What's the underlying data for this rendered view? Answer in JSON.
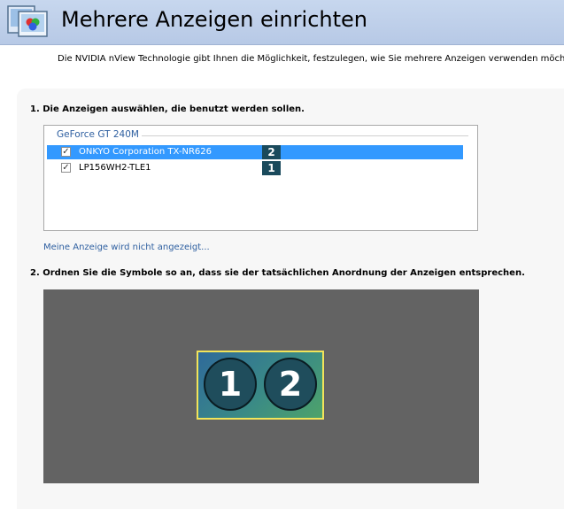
{
  "header": {
    "title": "Mehrere Anzeigen einrichten",
    "icon": "nvidia-displays-icon"
  },
  "intro": "Die NVIDIA nView Technologie gibt Ihnen die Möglichkeit, festzulegen, wie Sie mehrere Anzeigen verwenden möchten.",
  "step1": {
    "label": "1. Die Anzeigen auswählen, die benutzt werden sollen."
  },
  "gpu": {
    "name": "GeForce GT 240M"
  },
  "displays": [
    {
      "label": "ONKYO Corporation TX-NR626",
      "number": "2",
      "checked": true,
      "selected": true
    },
    {
      "label": "LP156WH2-TLE1",
      "number": "1",
      "checked": true,
      "selected": false
    }
  ],
  "link": "Meine Anzeige wird nicht angezeigt...",
  "step2": {
    "label": "2. Ordnen Sie die Symbole so an, dass sie der tatsächlichen Anordnung der Anzeigen entsprechen."
  },
  "arrangement": {
    "icons": [
      "1",
      "2"
    ]
  },
  "colors": {
    "accent_selection": "#3399ff",
    "canvas": "#636363",
    "group_border": "#f2e45a",
    "badge": "#1a4a5c"
  }
}
